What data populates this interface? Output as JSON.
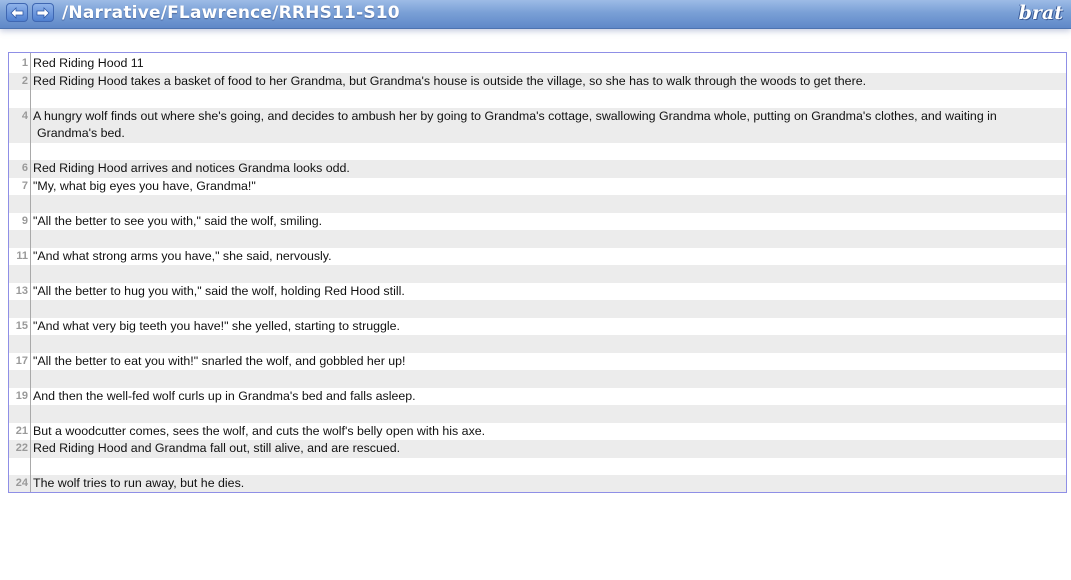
{
  "header": {
    "doc_path": "/Narrative/FLawrence/RRHS11-S10",
    "logo": "brat",
    "prev_icon": "arrow-left-icon",
    "next_icon": "arrow-right-icon"
  },
  "colors": {
    "header_blue": "#7aa0d6",
    "alt_row": "#ececec",
    "border": "#8f8fe6",
    "line_number": "#9a9a9a"
  },
  "lines": [
    {
      "num": "1",
      "text": "Red Riding Hood 11"
    },
    {
      "num": "2",
      "text": "Red Riding Hood takes a basket of food to her Grandma, but Grandma's house is outside the village, so she has to walk through the woods to get there."
    },
    {
      "num": "",
      "text": ""
    },
    {
      "num": "4",
      "text": "A hungry wolf finds out where she's going, and decides to ambush her by going to Grandma's cottage, swallowing Grandma whole, putting on Grandma's clothes, and waiting in",
      "cont": "Grandma's bed."
    },
    {
      "num": "",
      "text": ""
    },
    {
      "num": "6",
      "text": "Red Riding Hood arrives and notices Grandma looks odd."
    },
    {
      "num": "7",
      "text": "\"My, what big eyes you have, Grandma!\""
    },
    {
      "num": "",
      "text": ""
    },
    {
      "num": "9",
      "text": "\"All the better to see you with,\" said the wolf, smiling."
    },
    {
      "num": "",
      "text": ""
    },
    {
      "num": "11",
      "text": "\"And what strong arms you have,\" she said, nervously."
    },
    {
      "num": "",
      "text": ""
    },
    {
      "num": "13",
      "text": "\"All the better to hug you with,\" said the wolf, holding Red Hood still."
    },
    {
      "num": "",
      "text": ""
    },
    {
      "num": "15",
      "text": "\"And what very big teeth you have!\" she yelled, starting to struggle."
    },
    {
      "num": "",
      "text": ""
    },
    {
      "num": "17",
      "text": "\"All the better to eat you with!\" snarled the wolf, and gobbled her up!"
    },
    {
      "num": "",
      "text": ""
    },
    {
      "num": "19",
      "text": "And then the well-fed wolf curls up in Grandma's bed and falls asleep."
    },
    {
      "num": "",
      "text": ""
    },
    {
      "num": "21",
      "text": "But a woodcutter comes, sees the wolf, and cuts the wolf's belly open with his axe."
    },
    {
      "num": "22",
      "text": "Red Riding Hood and Grandma fall out, still alive, and are rescued."
    },
    {
      "num": "",
      "text": ""
    },
    {
      "num": "24",
      "text": "The wolf tries to run away, but he dies."
    }
  ]
}
